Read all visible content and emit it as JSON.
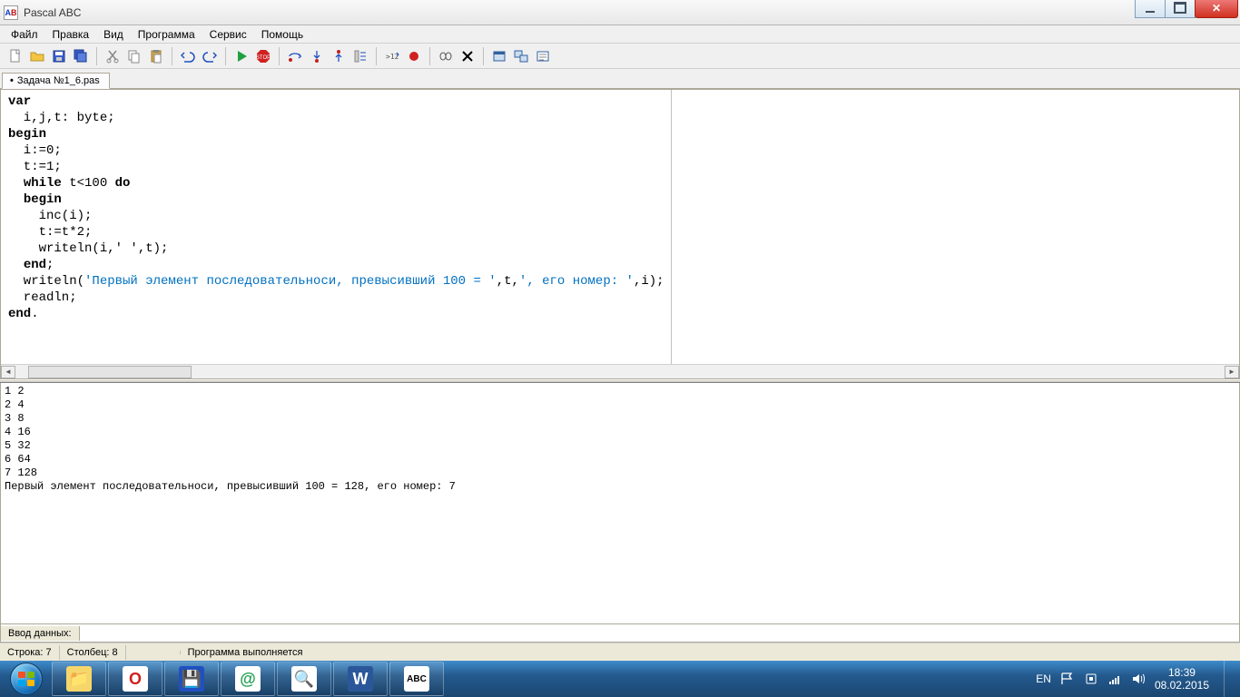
{
  "window": {
    "title": "Pascal ABC"
  },
  "menu": [
    "Файл",
    "Правка",
    "Вид",
    "Программа",
    "Сервис",
    "Помощь"
  ],
  "tab": {
    "modified": "•",
    "name": "Задача №1_6.pas"
  },
  "code": {
    "l1_kw": "var",
    "l2": "  i,j,t: byte;",
    "l3_kw": "begin",
    "l4": "  i:=0;",
    "l5": "  t:=1;",
    "l6a": "  ",
    "l6_kw1": "while",
    "l6b": " t<100 ",
    "l6_kw2": "do",
    "l7a": "  ",
    "l7_kw": "begin",
    "l8": "    inc(i);",
    "l9": "    t:=t*2;",
    "l10": "    writeln(i,' ',t);",
    "l11a": "  ",
    "l11_kw": "end",
    "l11b": ";",
    "l12a": "  writeln(",
    "l12_str1": "'Первый элемент последовательноси, превысивший 100 = '",
    "l12b": ",t,",
    "l12_str2": "', его номер: '",
    "l12c": ",i);",
    "l13": "  readln;",
    "l14_kw": "end",
    "l14b": "."
  },
  "output_lines": [
    "1 2",
    "2 4",
    "3 8",
    "4 16",
    "5 32",
    "6 64",
    "7 128",
    "Первый элемент последовательноси, превысивший 100 = 128, его номер: 7"
  ],
  "input": {
    "label": "Ввод данных:",
    "value": ""
  },
  "status": {
    "line": "Строка: 7",
    "col": "Столбец: 8",
    "msg": "Программа выполняется"
  },
  "tray": {
    "lang": "EN",
    "time": "18:39",
    "date": "08.02.2015"
  },
  "toolbar_icons": [
    "new-file-icon",
    "open-file-icon",
    "save-icon",
    "save-all-icon",
    "sep",
    "cut-icon",
    "copy-icon",
    "paste-icon",
    "sep",
    "undo-icon",
    "redo-icon",
    "sep",
    "run-icon",
    "stop-icon",
    "sep",
    "step-over-icon",
    "step-into-icon",
    "step-out-icon",
    "run-to-cursor-icon",
    "sep",
    "watch-icon",
    "breakpoint-icon",
    "sep",
    "evaluate-icon",
    "clear-output-icon",
    "sep",
    "form-new-icon",
    "form-link-icon",
    "form-design-icon"
  ],
  "taskbar_apps": [
    {
      "name": "explorer",
      "bg": "#f6d66a",
      "fg": "#b47a10",
      "txt": "📁"
    },
    {
      "name": "opera",
      "bg": "#fff",
      "fg": "#d02020",
      "txt": "O"
    },
    {
      "name": "save-app",
      "bg": "#2050c0",
      "fg": "#fff",
      "txt": "💾"
    },
    {
      "name": "mail",
      "bg": "#fff",
      "fg": "#20a050",
      "txt": "@"
    },
    {
      "name": "magnifier",
      "bg": "#fff",
      "fg": "#3070c0",
      "txt": "🔍"
    },
    {
      "name": "word",
      "bg": "#2b579a",
      "fg": "#fff",
      "txt": "W"
    },
    {
      "name": "pascal-abc",
      "bg": "#fff",
      "fg": "#000",
      "txt": "ABC"
    }
  ]
}
